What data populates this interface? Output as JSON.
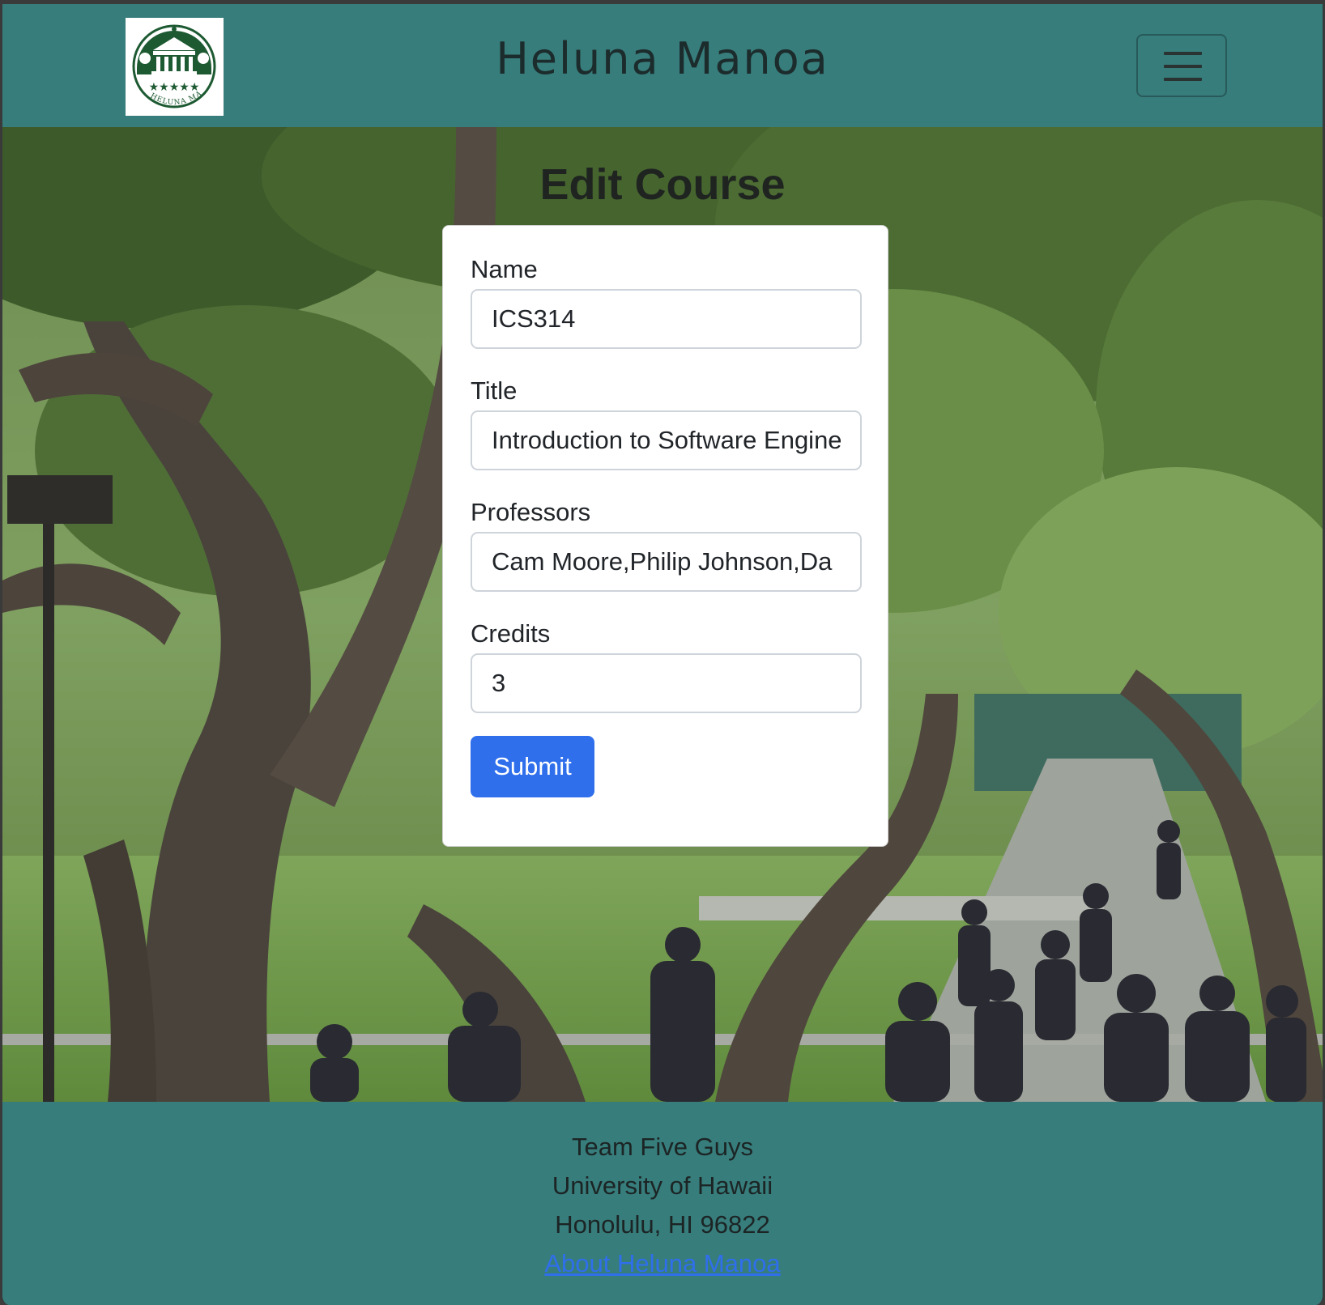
{
  "navbar": {
    "brand": "Heluna Manoa",
    "logo_text": "HELUNA MANOA",
    "menu_icon": "hamburger-menu-icon"
  },
  "page": {
    "title": "Edit Course"
  },
  "form": {
    "name_label": "Name",
    "name_value": "ICS314",
    "title_label": "Title",
    "title_value": "Introduction to Software Engineering",
    "professors_label": "Professors",
    "professors_value": "Cam Moore,Philip Johnson,Da",
    "credits_label": "Credits",
    "credits_value": "3",
    "submit_label": "Submit"
  },
  "footer": {
    "team": "Team Five Guys",
    "university": "University of Hawaii",
    "location": "Honolulu, HI 96822",
    "about_link": "About Heluna Manoa"
  },
  "colors": {
    "theme": "#377d7c",
    "primary": "#2f6fec"
  }
}
